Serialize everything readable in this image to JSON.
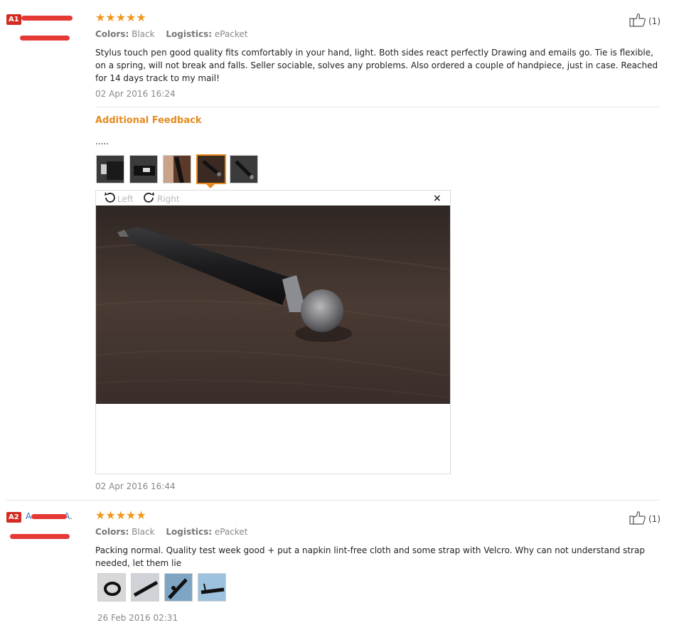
{
  "reviews": [
    {
      "badge": "A1",
      "stars": "★★★★★",
      "colors_label": "Colors:",
      "colors_value": "Black",
      "logistics_label": "Logistics:",
      "logistics_value": "ePacket",
      "text": "Stylus touch pen good quality fits comfortably in your hand, light. Both sides react perfectly Drawing and emails go. Tie is flexible, on a spring, will not break and falls. Seller sociable, solves any problems. Also ordered a couple of handpiece, just in case. Reached for 14 days track to my mail!",
      "date": "02 Apr 2016 16:24",
      "likes": "(1)",
      "additional": {
        "title": "Additional Feedback",
        "text": ".....",
        "date": "02 Apr 2016 16:44",
        "viewer": {
          "left_label": "Left",
          "right_label": "Right",
          "close": "×"
        }
      }
    },
    {
      "badge": "A2",
      "name": "A",
      "name_tail": "A.",
      "stars": "★★★★★",
      "colors_label": "Colors:",
      "colors_value": "Black",
      "logistics_label": "Logistics:",
      "logistics_value": "ePacket",
      "text": "Packing normal. Quality test week good + put a napkin lint-free cloth and some strap with Velcro. Why can not understand strap needed, let them lie",
      "date": "26 Feb 2016 02:31",
      "likes": "(1)"
    }
  ],
  "colors": {
    "star": "#f0961a",
    "accent": "#e68a1f",
    "badge": "#d22b1f",
    "redaction": "#e53935"
  },
  "icons": {
    "like": "thumbs-up-icon",
    "rotate_left": "rotate-left-icon",
    "rotate_right": "rotate-right-icon",
    "close": "close-icon"
  }
}
